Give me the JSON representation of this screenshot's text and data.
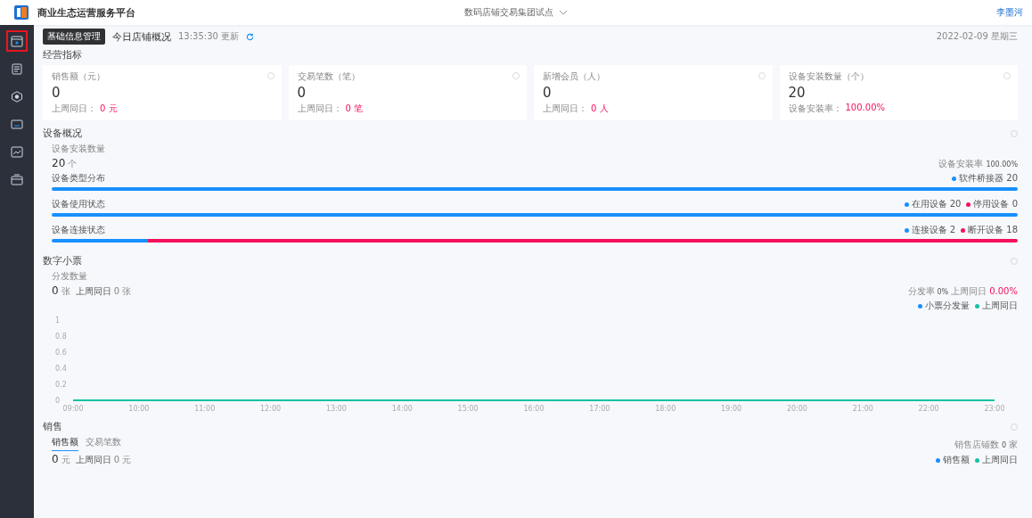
{
  "header": {
    "title": "商业生态运营服务平台",
    "store_selector": "数码店铺交易集团试点",
    "user": "李墨河"
  },
  "sidebar": {
    "items": [
      {
        "selected": true
      },
      {
        "selected": false
      },
      {
        "selected": false
      },
      {
        "selected": false
      },
      {
        "selected": false
      },
      {
        "selected": false
      }
    ],
    "tooltip": "基础信息管理"
  },
  "overview": {
    "title": "今日店铺概况",
    "updated": "13:35:30 更新",
    "date": "2022-02-09 星期三"
  },
  "kpi": {
    "title": "经营指标",
    "cards": [
      {
        "label": "销售额（元）",
        "value": "0",
        "compare_label": "上周同日：",
        "compare_value": "0 元"
      },
      {
        "label": "交易笔数（笔）",
        "value": "0",
        "compare_label": "上周同日：",
        "compare_value": "0 笔"
      },
      {
        "label": "新增会员（人）",
        "value": "0",
        "compare_label": "上周同日：",
        "compare_value": "0 人"
      },
      {
        "label": "设备安装数量（个）",
        "value": "20",
        "compare_label": "设备安装率：",
        "compare_value": "100.00%"
      }
    ]
  },
  "devices": {
    "title": "设备概况",
    "count_label": "设备安装数量",
    "count": "20",
    "unit": "个",
    "rate_label": "设备安装率",
    "rate": "100.00%",
    "bars": [
      {
        "label": "设备类型分布",
        "segments": [
          {
            "name": "软件桥接器",
            "value": "20",
            "level": 1,
            "color": "#1890ff"
          }
        ]
      },
      {
        "label": "设备使用状态",
        "segments": [
          {
            "name": "在用设备",
            "value": "20",
            "level": 1,
            "color": "#1890ff"
          },
          {
            "name": "停用设备",
            "value": "0",
            "level": 0,
            "color": "#f5115b"
          }
        ]
      },
      {
        "label": "设备连接状态",
        "segments": [
          {
            "name": "连接设备",
            "value": "2",
            "level": 0.1,
            "color": "#1890ff"
          },
          {
            "name": "断开设备",
            "value": "18",
            "level": 0.9,
            "color": "#f5115b"
          }
        ]
      }
    ]
  },
  "receipts": {
    "title": "数字小票",
    "count_label": "分发数量",
    "count": "0",
    "unit": "张",
    "compare_label": "上周同日",
    "compare_value": "0",
    "compare_unit": "张",
    "rate_label": "分发率",
    "rate": "0%",
    "prev_rate_label": "上周同日",
    "prev_rate": "0.00%",
    "chart_data": {
      "type": "line",
      "categories": [
        "09:00",
        "10:00",
        "11:00",
        "12:00",
        "13:00",
        "14:00",
        "15:00",
        "16:00",
        "17:00",
        "18:00",
        "19:00",
        "20:00",
        "21:00",
        "22:00",
        "23:00"
      ],
      "ylim": [
        0,
        1
      ],
      "yticks": [
        0,
        0.2,
        0.4,
        0.6,
        0.8,
        1
      ],
      "series": [
        {
          "name": "小票分发量",
          "color": "#1890ff",
          "values": [
            null,
            null,
            null,
            null,
            null,
            null,
            null,
            null,
            null,
            null,
            null,
            null,
            null,
            null,
            null
          ]
        },
        {
          "name": "上周同日",
          "color": "#13c2a3",
          "values": [
            0,
            0,
            0,
            0,
            0,
            0,
            0,
            0,
            0,
            0,
            0,
            0,
            0,
            0,
            0
          ]
        }
      ]
    }
  },
  "sales": {
    "title": "销售",
    "tabs": [
      {
        "label": "销售额",
        "selected": true
      },
      {
        "label": "交易笔数",
        "selected": false
      }
    ],
    "value": "0",
    "unit": "元",
    "compare_label": "上周同日",
    "compare_value": "0",
    "compare_unit": "元",
    "stores_label": "销售店铺数",
    "stores": "0",
    "stores_unit": "家",
    "legend": [
      {
        "name": "销售额",
        "color": "#1890ff"
      },
      {
        "name": "上周同日",
        "color": "#13c2a3"
      }
    ]
  }
}
